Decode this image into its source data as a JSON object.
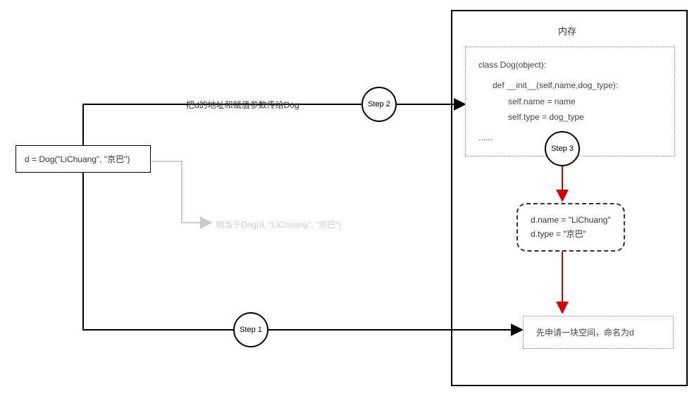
{
  "left_box": {
    "code": "d = Dog(\"LiChuang\", \"京巴\")"
  },
  "equiv_label": "相当于Dog(d, \"LiChuang\", \"京巴\")",
  "top_edge_label": "把d的地址和赋值参数传给Dog",
  "steps": {
    "s1": "Step 1",
    "s2": "Step 2",
    "s3": "Step 3"
  },
  "memory": {
    "title": "内存",
    "class_code_l1": "class Dog(object):",
    "class_code_l2": "def __init__(self,name,dog_type):",
    "class_code_l3": "self.name = name",
    "class_code_l4": "self.type = dog_type",
    "class_code_l5": "......",
    "result_l1": "d.name = \"LiChuang\"",
    "result_l2": "d.type = \"京巴\"",
    "alloc": "先申请一块空间，命名为d"
  }
}
